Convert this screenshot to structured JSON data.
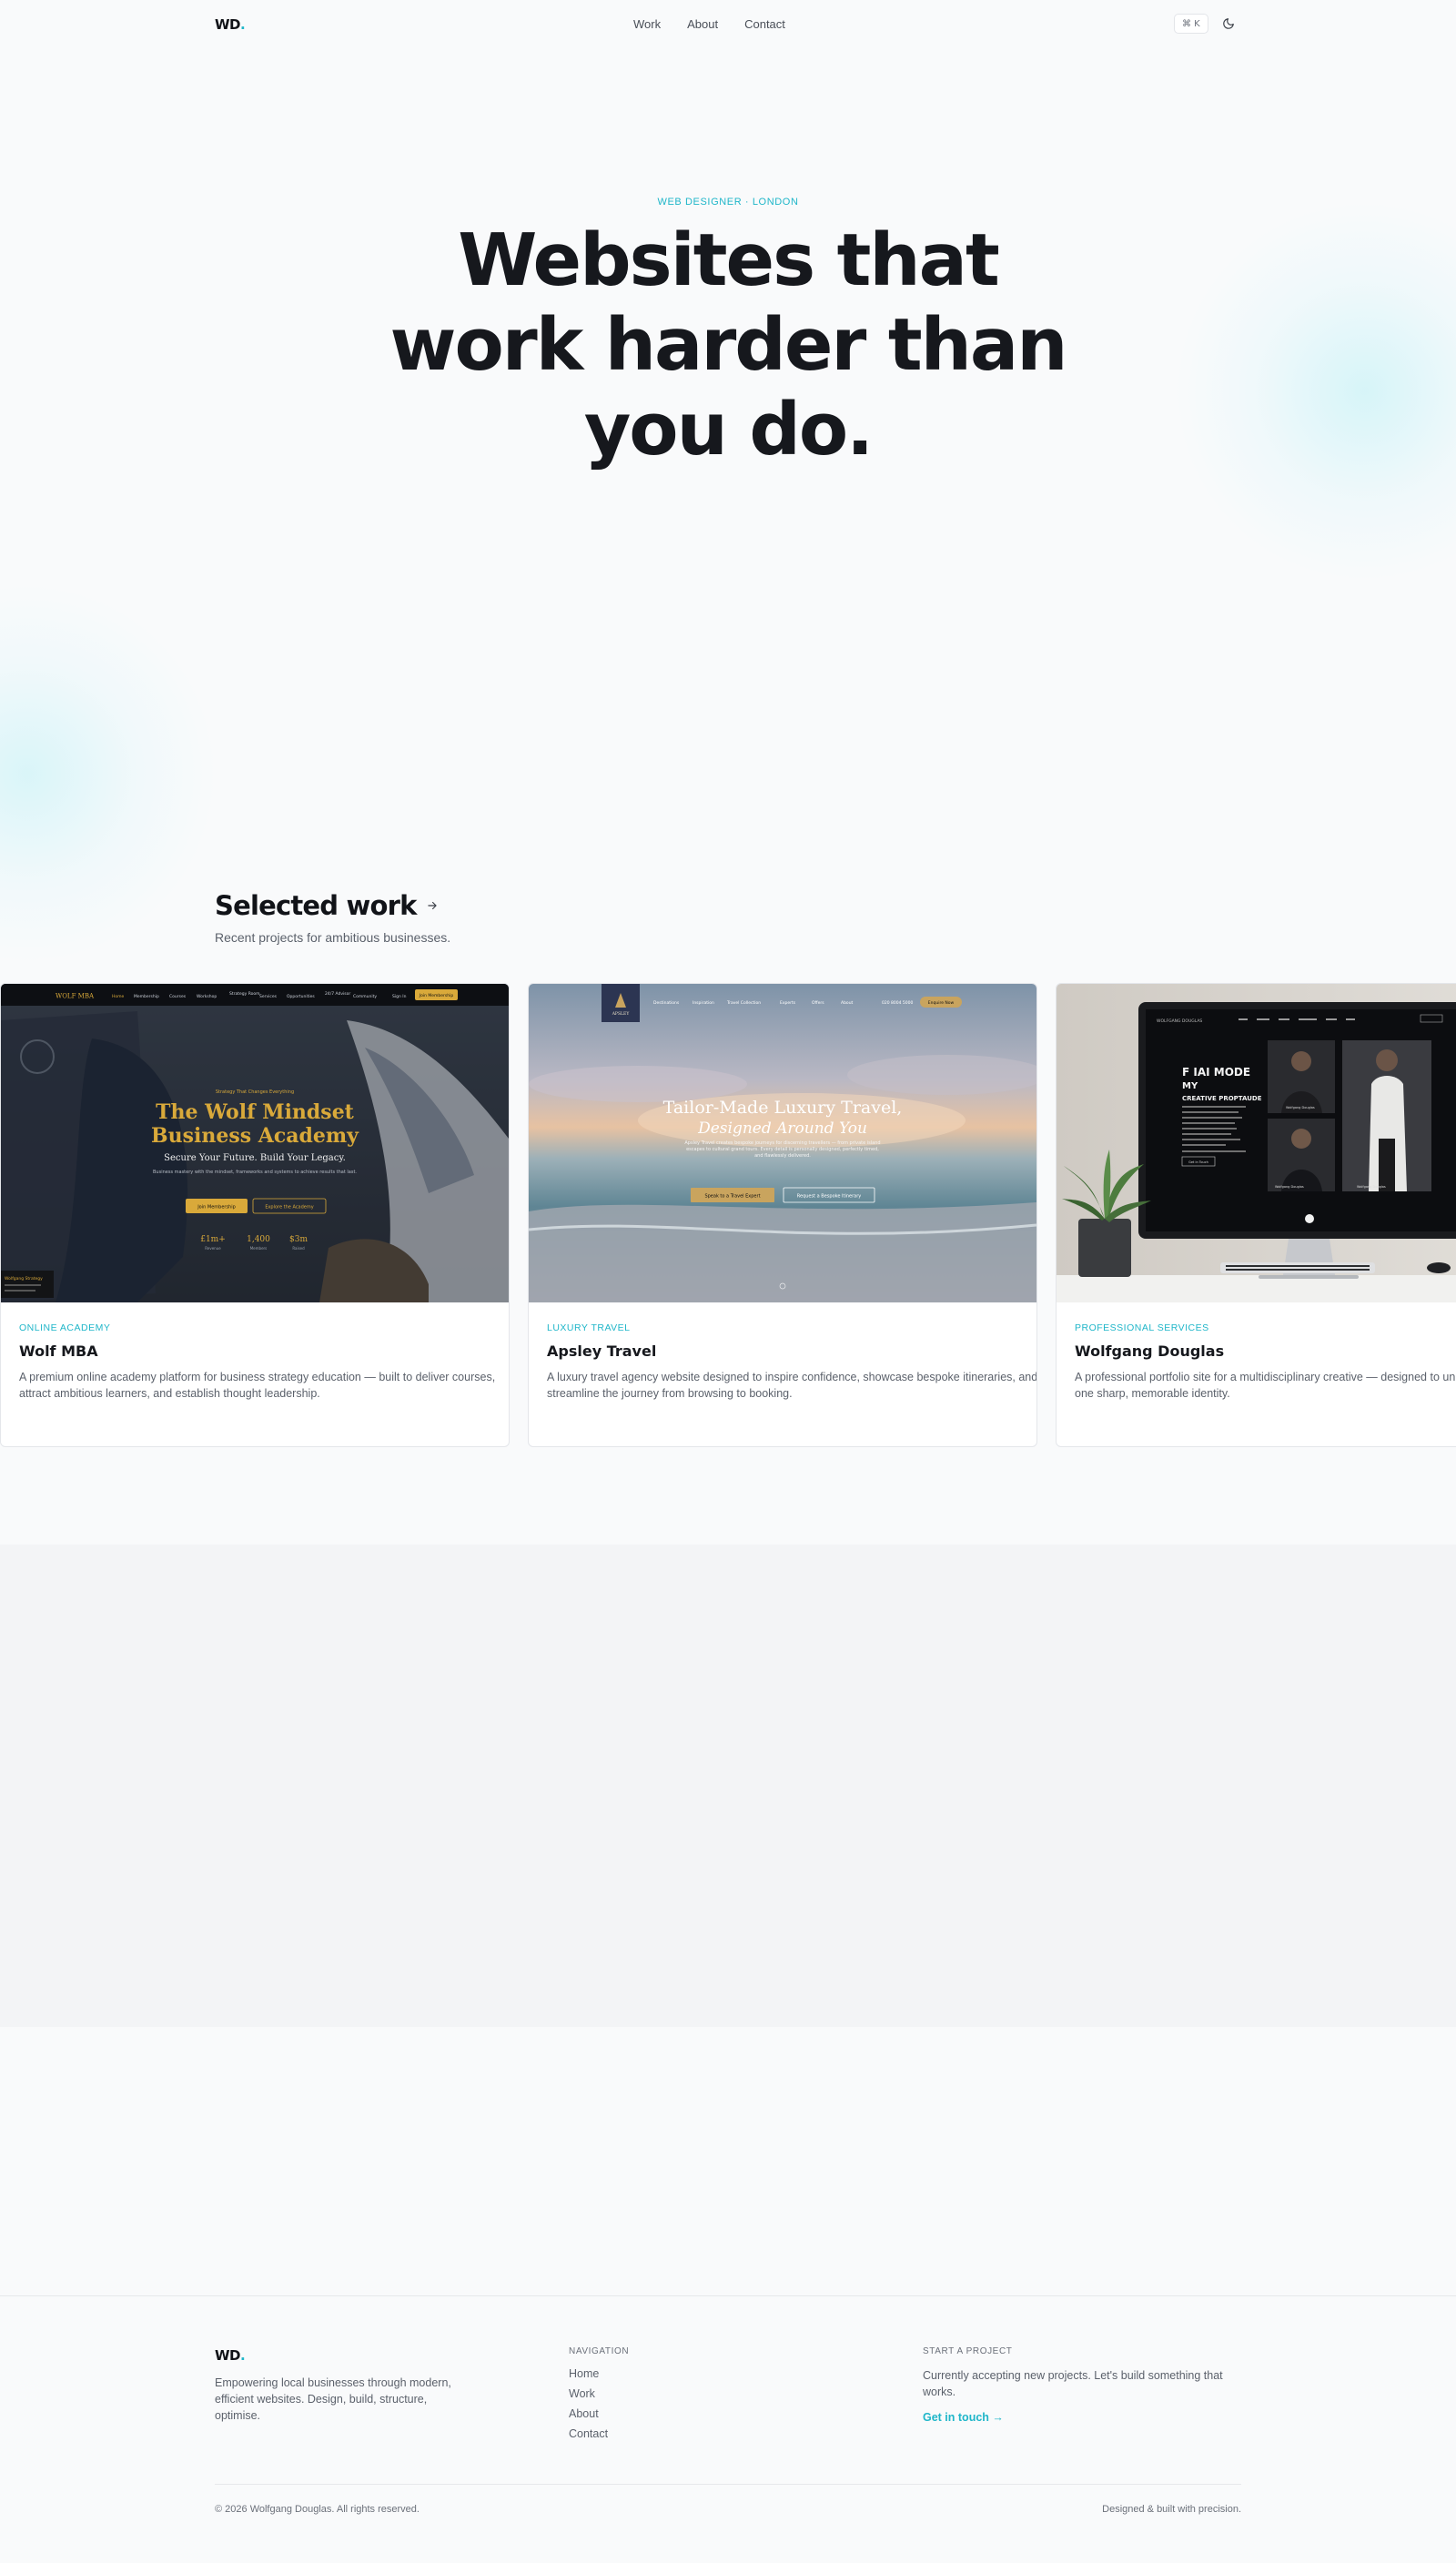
{
  "nav": {
    "logo_text": "WD",
    "logo_dot": ".",
    "links": [
      "Work",
      "About",
      "Contact"
    ],
    "command_shortcut": "⌘ K",
    "theme_icon": "moon-icon"
  },
  "hero": {
    "eyebrow": "WEB DESIGNER · LONDON",
    "title": "Websites that work harder than you do.",
    "subtitle": ""
  },
  "work": {
    "title": "Selected work",
    "title_icon": "arrow-right-icon",
    "subtitle": "Recent projects for ambitious businesses.",
    "projects": [
      {
        "tag": "ONLINE ACADEMY",
        "name": "Wolf MBA",
        "description": "A premium online academy platform for business strategy education — built to deliver courses, attract ambitious learners, and establish thought leadership.",
        "preview": {
          "brand": "WOLF MBA",
          "menu": [
            "Home",
            "Membership",
            "Courses",
            "Workshop",
            "Strategy Room",
            "Services",
            "Opportunities",
            "24/7 Advisor",
            "Community",
            "Sign In"
          ],
          "cta": "Join Membership",
          "eyebrow": "Strategy That Changes Everything",
          "headline_1": "The Wolf Mindset",
          "headline_2": "Business Academy",
          "tagline": "Secure Your Future. Build Your Legacy.",
          "body": "Business mastery with the mindset, frameworks and systems to achieve results that last.",
          "btn_primary": "Join Membership",
          "btn_secondary": "Explore the Academy",
          "stats": [
            {
              "value": "£1m+",
              "label": "Revenue"
            },
            {
              "value": "1,400",
              "label": "Members"
            },
            {
              "value": "$3m",
              "label": "Raised"
            }
          ],
          "badge": "Wolfgang Strategy"
        }
      },
      {
        "tag": "LUXURY TRAVEL",
        "name": "Apsley Travel",
        "description": "A luxury travel agency website designed to inspire confidence, showcase bespoke itineraries, and streamline the journey from browsing to booking.",
        "preview": {
          "brand": "APSLEY",
          "menu": [
            "Destinations",
            "Inspiration",
            "Travel Collection",
            "Experts",
            "Offers",
            "About"
          ],
          "phone": "020 8004 5000",
          "cta": "Enquire Now",
          "headline_1": "Tailor-Made Luxury Travel,",
          "headline_2": "Designed Around You",
          "body": "Apsley Travel creates bespoke journeys for discerning travellers — from private island escapes to cultural grand tours. Every detail is personally designed, perfectly timed, and flawlessly delivered.",
          "btn_primary": "Speak to a Travel Expert",
          "btn_secondary": "Request a Bespoke Itinerary"
        }
      },
      {
        "tag": "PROFESSIONAL SERVICES",
        "name": "Wolfgang Douglas",
        "description": "A professional portfolio site for a multidisciplinary creative — designed to unify expertise under one sharp, memorable identity.",
        "preview": {
          "brand": "WOLFGANG DOUGLAS",
          "headline_1": "F IAI MODE",
          "headline_2": "MY",
          "headline_3": "CREATIVE PROPTAUDE",
          "btn": "Get in Touch",
          "person_1": "Wolfgang Douglas",
          "person_2": "Wolfgang Douglas",
          "person_3": "Wolfgang Douglas"
        }
      }
    ]
  },
  "footer": {
    "logo_text": "WD",
    "logo_dot": ".",
    "tagline": "Empowering local businesses through modern, efficient websites. Design, build, structure, optimise.",
    "nav_heading": "NAVIGATION",
    "nav_links": [
      "Home",
      "Work",
      "About",
      "Contact"
    ],
    "project_heading": "START A PROJECT",
    "project_text": "Currently accepting new projects. Let's build something that works.",
    "project_cta": "Get in touch →",
    "copyright": "© 2026 Wolfgang Douglas. All rights reserved.",
    "built": "Designed & built with precision."
  },
  "colors": {
    "accent": "#1fb6c9",
    "text": "#111318",
    "muted": "#5b616b",
    "background": "#f9fafb",
    "wolf_gold": "#d9a93a",
    "apsley_gold": "#c9a45e"
  }
}
